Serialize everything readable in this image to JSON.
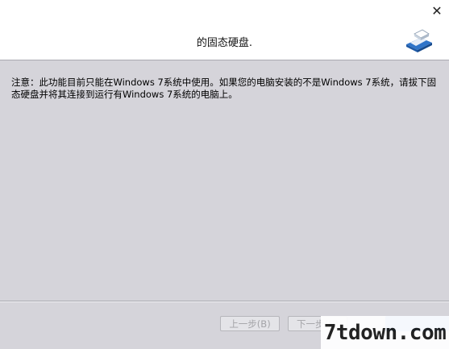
{
  "window": {
    "close_glyph": "✕",
    "title": "的固态硬盘."
  },
  "header": {
    "logo_icon": "disk-eraser-icon"
  },
  "main": {
    "notice": "注意：此功能目前只能在Windows 7系统中使用。如果您的电脑安装的不是Windows 7系统，请拔下固态硬盘并将其连接到运行有Windows 7系统的电脑上。"
  },
  "footer": {
    "prev_label": "上一步(B)",
    "next_label": "下一步(N)"
  },
  "watermark": {
    "text": "7tdown.com"
  },
  "colors": {
    "header_bg": "#ffffff",
    "body_bg": "#d5d4da",
    "accent_blue": "#3e7fd9",
    "disabled_text": "#a4a4a8"
  }
}
